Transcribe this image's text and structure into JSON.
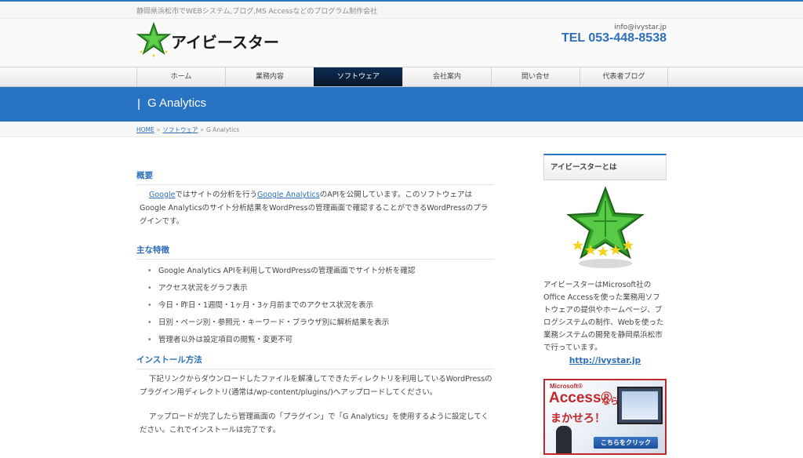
{
  "topbar": {
    "tagline": "静岡県浜松市でWEBシステム,ブログ,MS Accessなどのプログラム制作会社"
  },
  "header": {
    "logo_text": "アイビースター",
    "email": "info@ivystar.jp",
    "tel": "TEL 053-448-8538"
  },
  "nav": {
    "items": [
      {
        "label": "ホーム"
      },
      {
        "label": "業務内容"
      },
      {
        "label": "ソフトウェア"
      },
      {
        "label": "会社案内"
      },
      {
        "label": "問い合せ"
      },
      {
        "label": "代表者ブログ"
      }
    ],
    "active_index": 2
  },
  "page": {
    "title": "G Analytics"
  },
  "breadcrumb": {
    "home": "HOME",
    "sep": "»",
    "software": "ソフトウェア",
    "current": "G Analytics"
  },
  "main": {
    "overview": {
      "heading": "概要",
      "link1": "Google",
      "text1": "ではサイトの分析を行う",
      "link2": "Google Analytics",
      "text2": "のAPIを公開しています。このソフトウェアはGoogle Analyticsのサイト分析結果をWordPressの管理画面で確認することができるWordPressのプラグインです。"
    },
    "features": {
      "heading": "主な特徴",
      "items": [
        "Google Analytics APIを利用してWordPressの管理画面でサイト分析を確認",
        "アクセス状況をグラフ表示",
        "今日・昨日・1週間・1ヶ月・3ヶ月前までのアクセス状況を表示",
        "日別・ページ別・参照元・キーワード・ブラウザ別に解析結果を表示",
        "管理者以外は設定項目の閲覧・変更不可"
      ]
    },
    "install": {
      "heading": "インストール方法",
      "para1": "下記リンクからダウンロードしたファイルを解凍してできたディレクトリを利用しているWordPressのプラグイン用ディレクトリ(通常は/wp-content/plugins/)へアップロードしてください。",
      "para2": "アップロードが完了したら管理画面の「プラグイン」で「G Analytics」を使用するように設定してください。これでインストールは完了です。"
    }
  },
  "sidebar": {
    "heading": "アイビースターとは",
    "description": "アイビースターはMicrosoft社のOffice Accessを使った業務用ソフトウェアの提供やホームページ、ブログシステムの制作、Webを使った業務システムの開発を静岡県浜松市で行っています。",
    "link": "http://ivystar.jp",
    "banner": {
      "ms": "Microsoft®",
      "access": "Access®",
      "nara": "なら",
      "makase": "まかせろ！",
      "button": "こちらをクリック"
    }
  },
  "colors": {
    "accent": "#2873c4",
    "link": "#2c6fb8",
    "nav_active": "#0e2e56",
    "star_green": "#4cc43a",
    "banner_red": "#c0282c"
  }
}
